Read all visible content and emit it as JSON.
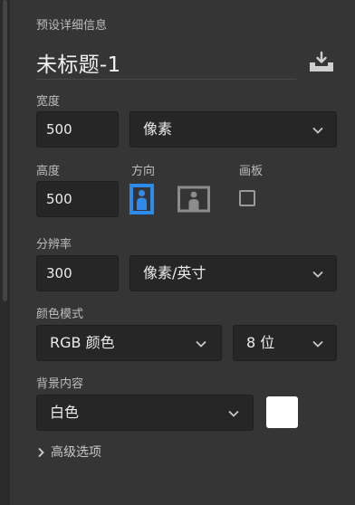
{
  "panel": {
    "section_title": "预设详细信息",
    "doc_name": "未标题-1"
  },
  "width": {
    "label": "宽度",
    "value": "500",
    "unit": "像素"
  },
  "height": {
    "label": "高度",
    "value": "500"
  },
  "orientation": {
    "label": "方向",
    "selected": "portrait",
    "options": [
      "portrait",
      "landscape"
    ],
    "accent": "#2d8ceb"
  },
  "artboard": {
    "label": "画板",
    "checked": false
  },
  "resolution": {
    "label": "分辨率",
    "value": "300",
    "unit": "像素/英寸"
  },
  "color_mode": {
    "label": "颜色模式",
    "mode": "RGB 颜色",
    "bit_depth": "8 位"
  },
  "background": {
    "label": "背景内容",
    "value": "白色",
    "swatch_color": "#ffffff"
  },
  "advanced": {
    "label": "高级选项"
  },
  "icons": [
    "save-preset-icon",
    "chevron-down-icon",
    "portrait-icon",
    "landscape-icon",
    "chevron-right-icon"
  ]
}
